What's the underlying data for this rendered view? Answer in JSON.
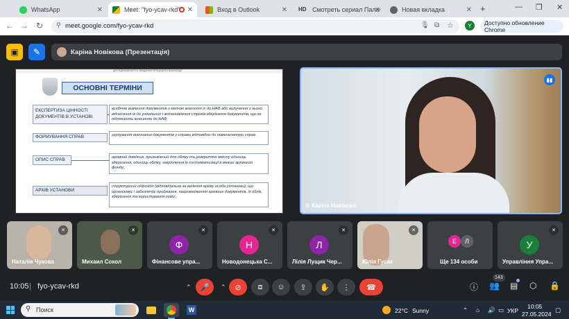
{
  "browser": {
    "tabs": [
      {
        "label": "WhatsApp",
        "icon": "whatsapp-icon",
        "color": "#25d366"
      },
      {
        "label": "Meet: \"fyo-ycav-rkd\"",
        "icon": "meet-icon",
        "color": "#00832d"
      },
      {
        "label": "Вход в Outlook",
        "icon": "microsoft-icon",
        "color": "#f25022"
      },
      {
        "label": "Смотреть сериал Палач / Ка",
        "icon": "hd-icon",
        "color": "#333333"
      },
      {
        "label": "Новая вкладка",
        "icon": "chrome-icon",
        "color": "#5f6368"
      }
    ],
    "new_tab": "+",
    "url": "meet.google.com/fyo-ycav-rkd",
    "profile_letter": "Y",
    "update_label": "Доступно обновление Chrome"
  },
  "meet": {
    "presenter_label": "Каріна Новікова (Презентація)",
    "slide": {
      "title": "ОСНОВНІ ТЕРМІНИ",
      "header_small": "ДІЯ ПІДЛИШЕННЯ ТА ЗАВДАННЯ ПРОЦЕДУРИ ВЗАЄМОДІЇ",
      "terms": [
        {
          "term": "ЕКСПЕРТИЗА ЦІННОСТІ ДОКУМЕНТІВ В УСТАНОВІ",
          "definition": "всебічне вивчення документів з метою внесення їх до НАФ або вилучення з нього, віднесення їх до унікальних і встановлення строків зберігання документів, що не підлягають внесенню до НАФ;"
        },
        {
          "term": "ФОРМУВАННЯ СПРАВ",
          "definition": "групування виконаних документів у справи відповідно до номенклатури справ."
        },
        {
          "term": "ОПИС СПРАВ",
          "definition": "архівний довідник, призначений для обліку та розкриття змісту одиниць зберігання, одиниць обліку, закріплення їх систематизації в межах архівного фонду;"
        },
        {
          "term": "АРХІВ УСТАНОВИ",
          "definition": "структурний підрозділ (відповідальна за ведення архіву особа установи), що організовує і забезпечує приймання, нагромадження архівних документів, їх облік, зберігання та користування ними;"
        }
      ]
    },
    "camera_name": "Каріна Новікова",
    "participants": [
      {
        "name": "Наталія Чукова",
        "type": "video",
        "bg": "#b9b2a8"
      },
      {
        "name": "Михаил Сокол",
        "type": "video",
        "bg": "#4a5a46"
      },
      {
        "name": "Фінансове упра...",
        "type": "avatar",
        "letter": "Ф",
        "color": "#8e24aa"
      },
      {
        "name": "Новодонецька С...",
        "type": "avatar",
        "letter": "Н",
        "color": "#e52592"
      },
      {
        "name": "Лілія Лущик Чер...",
        "type": "avatar",
        "letter": "Л",
        "color": "#8e24aa"
      },
      {
        "name": "Юлія Гусак",
        "type": "video",
        "bg": "#cfcfc6"
      },
      {
        "name": "Ще 134 особи",
        "type": "more",
        "letters": [
          "Е",
          "Л"
        ]
      },
      {
        "name": "Управління Упра...",
        "type": "avatar",
        "letter": "У",
        "color": "#188038"
      }
    ],
    "time": "10:05",
    "meeting_code": "fyo-ycav-rkd",
    "people_count": "143"
  },
  "taskbar": {
    "search_placeholder": "Поиск",
    "weather_temp": "22°C",
    "weather_desc": "Sunny",
    "lang": "УКР",
    "clock_time": "10:05",
    "clock_date": "27.05.2024"
  }
}
